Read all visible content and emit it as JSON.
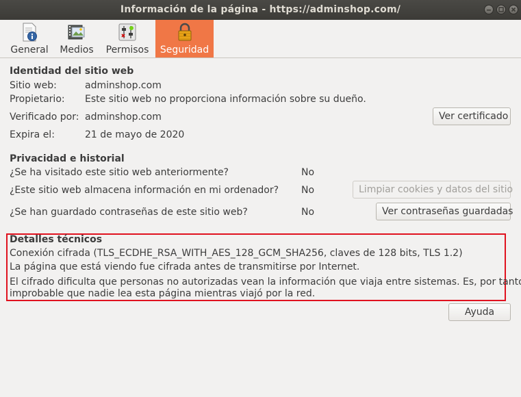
{
  "window": {
    "title": "Información de la página - https://adminshop.com/",
    "controls": [
      "minimize-icon",
      "maximize-icon",
      "close-icon"
    ]
  },
  "tabs": [
    {
      "label": "General",
      "icon": "document-info-icon",
      "active": false
    },
    {
      "label": "Medios",
      "icon": "media-film-icon",
      "active": false
    },
    {
      "label": "Permisos",
      "icon": "permissions-toggle-icon",
      "active": false
    },
    {
      "label": "Seguridad",
      "icon": "padlock-icon",
      "active": true
    }
  ],
  "identity": {
    "heading": "Identidad del sitio web",
    "site_label": "Sitio web:",
    "site_value": "adminshop.com",
    "owner_label": "Propietario:",
    "owner_value": "Este sitio web no proporciona información sobre su dueño.",
    "verified_label": "Verificado por:",
    "verified_value": "adminshop.com",
    "expires_label": "Expira el:",
    "expires_value": "21 de mayo de 2020",
    "view_cert_button": "Ver certificado"
  },
  "privacy": {
    "heading": "Privacidad e historial",
    "visited_question": "¿Se ha visitado este sitio web anteriormente?",
    "visited_answer": "No",
    "storage_question": "¿Este sitio web almacena información en mi ordenador?",
    "storage_answer": "No",
    "clear_cookies_button": "Limpiar cookies y datos del sitio",
    "passwords_question": "¿Se han guardado contraseñas de este sitio web?",
    "passwords_answer": "No",
    "view_passwords_button": "Ver contraseñas guardadas"
  },
  "technical": {
    "heading": "Detalles técnicos",
    "connection": "Conexión cifrada (TLS_ECDHE_RSA_WITH_AES_128_GCM_SHA256, claves de 128 bits, TLS 1.2)",
    "encrypted_note": "La página que está viendo fue cifrada antes de transmitirse por Internet.",
    "explanation_line1": "El cifrado dificulta que personas no autorizadas vean la información que viaja entre sistemas. Es, por tanto,",
    "explanation_line2": "improbable que nadie lea esta página mientras viajó por la red.",
    "highlight_color": "#e0111e"
  },
  "help_button": "Ayuda",
  "colors": {
    "active_tab": "#f07746",
    "titlebar": "#3c3b37",
    "background": "#f2f1f0"
  }
}
